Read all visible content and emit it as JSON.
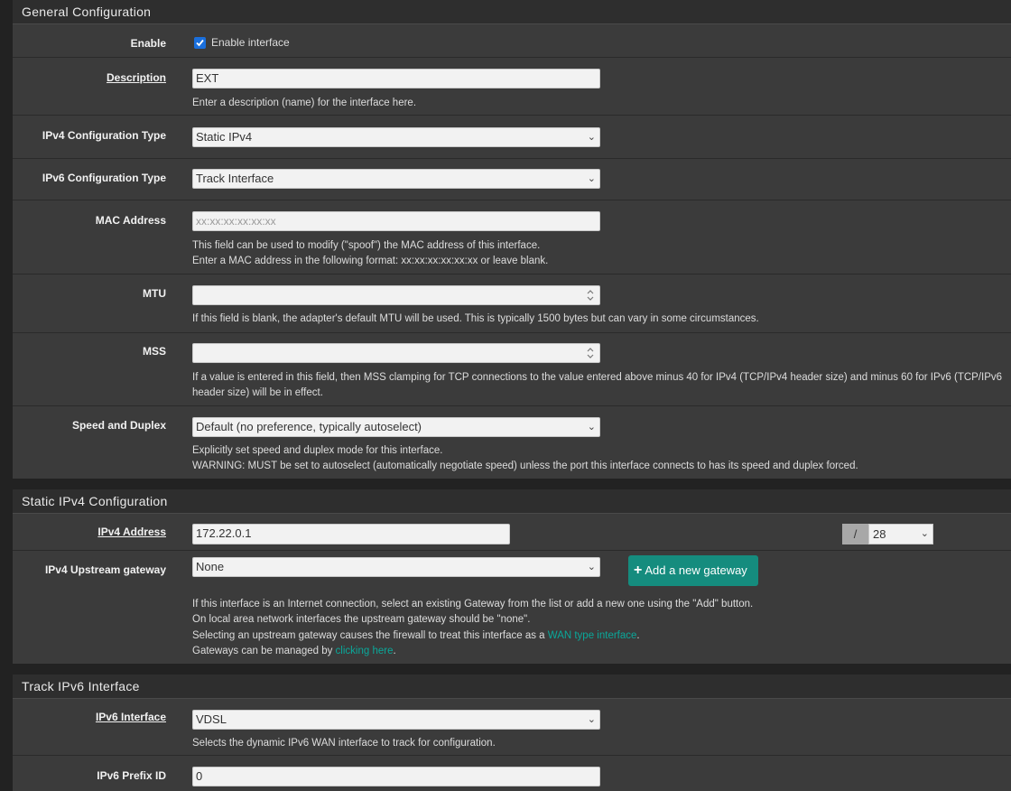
{
  "general": {
    "title": "General Configuration",
    "enable": {
      "label": "Enable",
      "checkbox_label": "Enable interface",
      "checked": true
    },
    "description": {
      "label": "Description",
      "value": "EXT",
      "help": "Enter a description (name) for the interface here."
    },
    "ipv4_type": {
      "label": "IPv4 Configuration Type",
      "value": "Static IPv4"
    },
    "ipv6_type": {
      "label": "IPv6 Configuration Type",
      "value": "Track Interface"
    },
    "mac": {
      "label": "MAC Address",
      "placeholder": "xx:xx:xx:xx:xx:xx",
      "help1": "This field can be used to modify (\"spoof\") the MAC address of this interface.",
      "help2": "Enter a MAC address in the following format: xx:xx:xx:xx:xx:xx or leave blank."
    },
    "mtu": {
      "label": "MTU",
      "value": "",
      "help": "If this field is blank, the adapter's default MTU will be used. This is typically 1500 bytes but can vary in some circumstances."
    },
    "mss": {
      "label": "MSS",
      "value": "",
      "help1": "If a value is entered in this field, then MSS clamping for TCP connections to the value entered above minus 40 for IPv4 (TCP/IPv4 header size) and minus 60 for IPv6 (TCP/IPv6",
      "help2": "header size) will be in effect."
    },
    "speed": {
      "label": "Speed and Duplex",
      "value": "Default (no preference, typically autoselect)",
      "help1": "Explicitly set speed and duplex mode for this interface.",
      "help2": "WARNING: MUST be set to autoselect (automatically negotiate speed) unless the port this interface connects to has its speed and duplex forced."
    }
  },
  "static_ipv4": {
    "title": "Static IPv4 Configuration",
    "address": {
      "label": "IPv4 Address",
      "value": "172.22.0.1",
      "slash": "/",
      "cidr": "28"
    },
    "gateway": {
      "label": "IPv4 Upstream gateway",
      "value": "None",
      "button": "Add a new gateway",
      "help1": "If this interface is an Internet connection, select an existing Gateway from the list or add a new one using the \"Add\" button.",
      "help2": "On local area network interfaces the upstream gateway should be \"none\".",
      "help3_pre": "Selecting an upstream gateway causes the firewall to treat this interface as a ",
      "help3_link": "WAN type interface",
      "help3_post": ".",
      "help4_pre": "Gateways can be managed by ",
      "help4_link": "clicking here",
      "help4_post": "."
    }
  },
  "track_ipv6": {
    "title": "Track IPv6 Interface",
    "interface": {
      "label": "IPv6 Interface",
      "value": "VDSL",
      "help": "Selects the dynamic IPv6 WAN interface to track for configuration."
    },
    "prefix": {
      "label": "IPv6 Prefix ID",
      "value": "0"
    }
  },
  "colors": {
    "accent": "#158c7e",
    "link": "#0aa89a",
    "checkbox": "#1a6fdc"
  }
}
